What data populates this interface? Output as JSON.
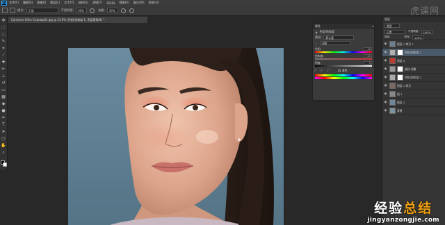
{
  "app": {
    "logo": "Ps"
  },
  "menu": [
    "文件(F)",
    "编辑(E)",
    "图像(I)",
    "图层(L)",
    "文字(Y)",
    "选择(S)",
    "滤镜(T)",
    "3D(D)",
    "视图(V)",
    "窗口(W)",
    "帮助(H)"
  ],
  "options": {
    "mode_label": "模式:",
    "mode_value": "正常",
    "opacity_label": "不透明度:",
    "opacity_value": "30%",
    "flow_label": "流量:",
    "flow_value": "30%"
  },
  "brand_top": "虎课网",
  "document": {
    "tab_title": "Cameron-Cfine-Catalog(6).jpg @ 23.9% (色相/饱和度 1, 图层蒙版/8) *"
  },
  "properties": {
    "title": "属性",
    "subtitle": "色相/饱和度",
    "preset_label": "预设:",
    "preset_value": "默认值",
    "channel_value": "全图",
    "hue_label": "色相:",
    "hue_value": "-19",
    "saturation_label": "饱和度:",
    "saturation_value": "+25",
    "lightness_label": "明度:",
    "lightness_value": "0",
    "colorize_label": "着色"
  },
  "layers": {
    "panel_title": "图层",
    "filter_label": "类型",
    "blend_mode": "正常",
    "opacity_label": "不透明度:",
    "opacity_value": "100%",
    "lock_label": "锁定:",
    "fill_label": "填充:",
    "fill_value": "100%",
    "items": [
      {
        "name": "图层 1 拷贝 2",
        "has_mask": false,
        "selected": false
      },
      {
        "name": "色相/饱和度 1",
        "has_mask": true,
        "selected": true
      },
      {
        "name": "图层 4",
        "has_mask": false,
        "selected": false
      },
      {
        "name": "曲线 调整",
        "has_mask": true,
        "selected": false
      },
      {
        "name": "色相/饱和度 2",
        "has_mask": true,
        "selected": false
      },
      {
        "name": "图层 1 拷贝",
        "has_mask": false,
        "selected": false
      },
      {
        "name": "组 1",
        "has_mask": false,
        "selected": false
      },
      {
        "name": "图层 2",
        "has_mask": false,
        "selected": false
      },
      {
        "name": "背景",
        "has_mask": false,
        "selected": false
      }
    ]
  },
  "watermark": {
    "line1_a": "经验",
    "line1_b": "总结",
    "line2": "jingyanzongjie.com"
  },
  "colors": {
    "panel": "#3b3b3b",
    "selection": "#4b5a6b",
    "photo_bg": "#5f7f93",
    "watermark_accent": "#f0a010"
  }
}
